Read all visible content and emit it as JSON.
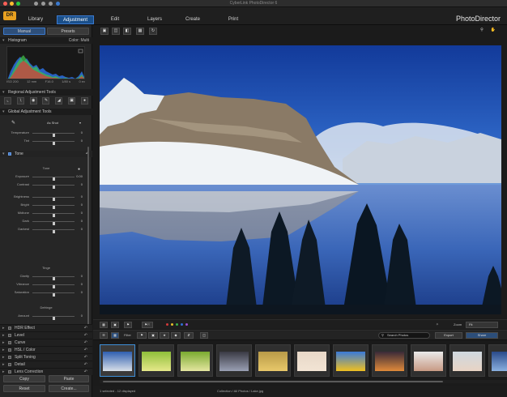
{
  "window": {
    "title": "CyberLink PhotoDirector 6",
    "traffic_lights": [
      "#ff5f57",
      "#febc2e",
      "#28c840"
    ]
  },
  "menubar": {
    "logo": "DR",
    "tabs": [
      {
        "label": "Library",
        "active": false
      },
      {
        "label": "Adjustment",
        "active": true
      },
      {
        "label": "Edit",
        "active": false
      },
      {
        "label": "Layers",
        "active": false
      },
      {
        "label": "Create",
        "active": false
      },
      {
        "label": "Print",
        "active": false
      }
    ],
    "brand": "PhotoDirector",
    "accent": "#3b7ad0"
  },
  "left_panel": {
    "modes": {
      "manual": "Manual",
      "presets": "Presets"
    },
    "histogram": {
      "title": "Histogram",
      "color_label": "Color",
      "color_value": "Multi",
      "info": [
        "ISO 200",
        "12 mm",
        "F16.0",
        "1/80 s",
        "0 ev"
      ]
    },
    "regional": {
      "title": "Regional Adjustment Tools",
      "tools": [
        "crop-icon",
        "straighten-icon",
        "redeye-icon",
        "brush-icon",
        "gradient-icon",
        "radial-icon",
        "spot-icon"
      ]
    },
    "global": {
      "title": "Global Adjustment Tools",
      "wb_dropdown": "As Shot",
      "wb_sliders": [
        {
          "label": "Temperature",
          "value": "0",
          "pos": 0.5
        },
        {
          "label": "Tint",
          "value": "0",
          "pos": 0.5
        }
      ]
    },
    "tone": {
      "title": "Tone",
      "subtitle": "Tone",
      "sliders_a": [
        {
          "label": "Exposure",
          "value": "0.00",
          "pos": 0.5
        },
        {
          "label": "Contrast",
          "value": "0",
          "pos": 0.5
        }
      ],
      "sliders_b": [
        {
          "label": "Brightness",
          "value": "0",
          "pos": 0.5
        },
        {
          "label": "Bright",
          "value": "0",
          "pos": 0.5
        },
        {
          "label": "Midtone",
          "value": "0",
          "pos": 0.5
        },
        {
          "label": "Dark",
          "value": "0",
          "pos": 0.5
        },
        {
          "label": "Darkest",
          "value": "0",
          "pos": 0.5
        }
      ],
      "tinge_title": "Tinge",
      "sliders_c": [
        {
          "label": "Clarity",
          "value": "0",
          "pos": 0.5
        },
        {
          "label": "Vibrance",
          "value": "0",
          "pos": 0.5
        },
        {
          "label": "Saturation",
          "value": "0",
          "pos": 0.5
        }
      ],
      "defringe_title": "Defringe",
      "sliders_d": [
        {
          "label": "Amount",
          "value": "0",
          "pos": 0.5
        }
      ]
    },
    "effects": [
      {
        "label": "HDR Effect"
      },
      {
        "label": "Level"
      },
      {
        "label": "Curve"
      },
      {
        "label": "HSL / Color"
      },
      {
        "label": "Split Toning"
      },
      {
        "label": "Detail"
      },
      {
        "label": "Lens Correction"
      }
    ],
    "buttons": {
      "copy": "Copy",
      "paste": "Paste",
      "reset": "Reset",
      "create": "Create..."
    }
  },
  "filmbar": {
    "view_label": "Zoom",
    "view_value": "Fit",
    "filter_label": "Filter",
    "search_placeholder": "Search Photos",
    "export": "Export",
    "share": "Share",
    "color_labels": [
      "#d23a3a",
      "#e6c02a",
      "#3ab04a",
      "#2f6fd8",
      "#9b4fd0"
    ]
  },
  "thumbnails": [
    {
      "name": "lake-mountains",
      "c1": "#2f5fb0",
      "c2": "#d8dfe8",
      "selected": true
    },
    {
      "name": "green-leaves",
      "c1": "#8fbf3a",
      "c2": "#e6e88a",
      "selected": false
    },
    {
      "name": "green-leaves-2",
      "c1": "#7aaa30",
      "c2": "#e4e6a0",
      "selected": false
    },
    {
      "name": "city-dusk",
      "c1": "#3a3a44",
      "c2": "#9aa0b4",
      "selected": false
    },
    {
      "name": "spiral-shell",
      "c1": "#b89a48",
      "c2": "#e8c86a",
      "selected": false
    },
    {
      "name": "portrait-girl",
      "c1": "#e8d8c8",
      "c2": "#f2e4d4",
      "selected": false
    },
    {
      "name": "sunflower",
      "c1": "#3a7ad8",
      "c2": "#f0c020",
      "selected": false
    },
    {
      "name": "sunset-pier",
      "c1": "#3a2a38",
      "c2": "#e08a3a",
      "selected": false
    },
    {
      "name": "portrait-woman",
      "c1": "#eaeaea",
      "c2": "#c89a84",
      "selected": false
    },
    {
      "name": "couple-beach",
      "c1": "#cfd8e0",
      "c2": "#e8d4c4",
      "selected": false
    },
    {
      "name": "partial-blue",
      "c1": "#2a4a8a",
      "c2": "#8ab0e0",
      "selected": false
    }
  ],
  "status": {
    "left": "1 selected - 12 displayed",
    "middle": "Collection / All Photos / Lake.jpg"
  }
}
